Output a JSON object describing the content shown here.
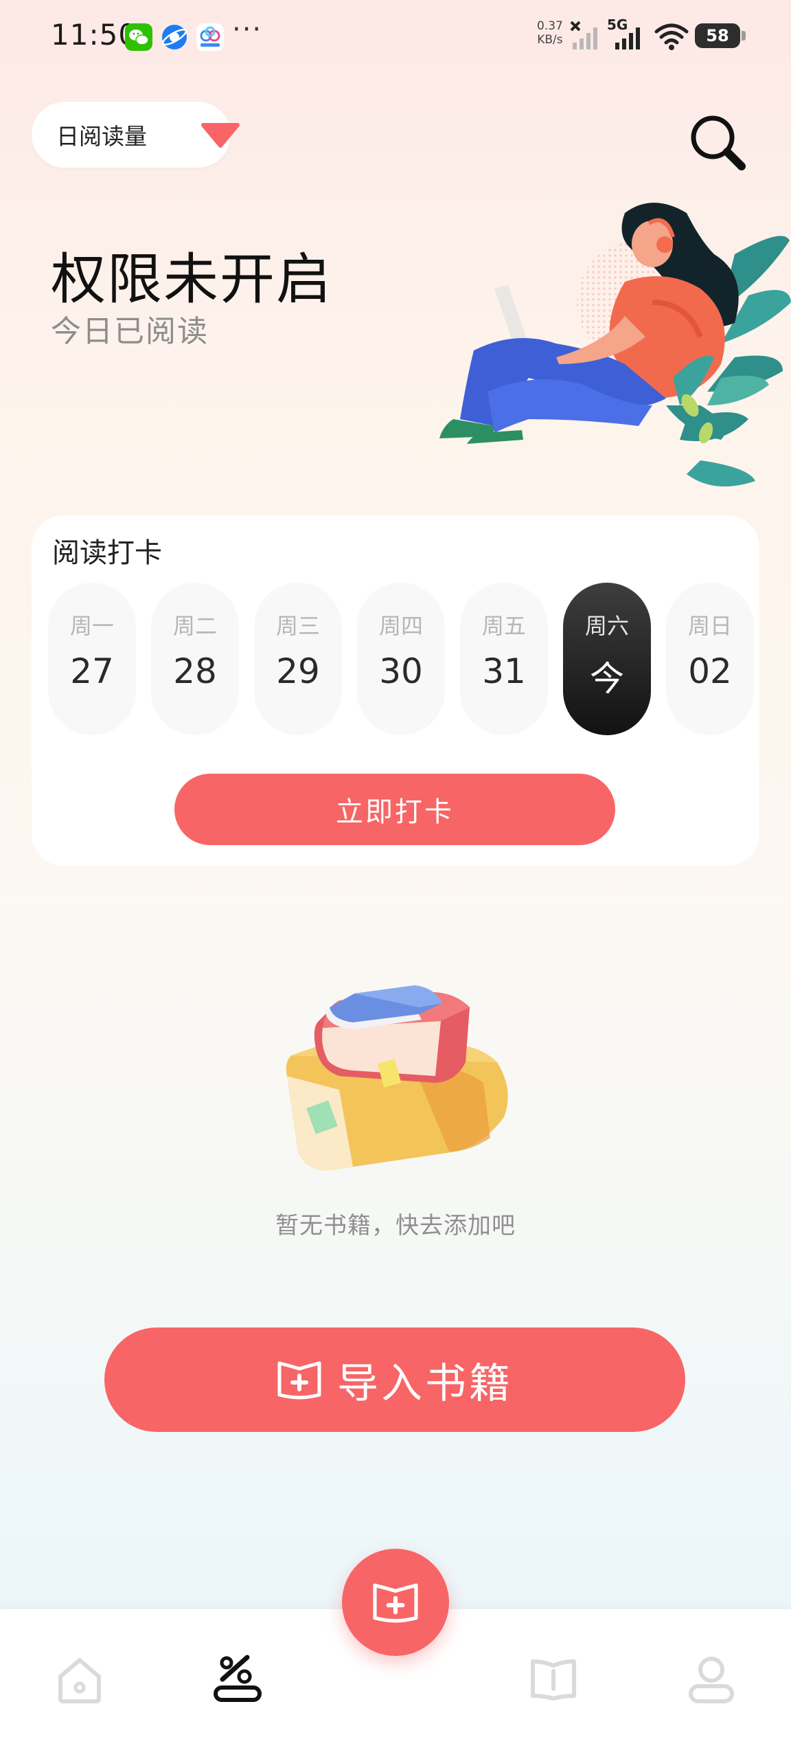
{
  "status_bar": {
    "time": "11:50",
    "net_speed_value": "0.37",
    "net_speed_unit": "KB/s",
    "network": "5G",
    "battery": "58",
    "apps": [
      "wechat-icon",
      "browser-icon",
      "baidu-netdisk-icon"
    ]
  },
  "header": {
    "daily_label": "日阅读量",
    "arrow_icon": "triangle-down-icon",
    "search_icon": "search-icon"
  },
  "hero": {
    "title": "权限未开启",
    "subtitle": "今日已阅读"
  },
  "checkin": {
    "title": "阅读打卡",
    "days": [
      {
        "weekday": "周一",
        "date": "27"
      },
      {
        "weekday": "周二",
        "date": "28"
      },
      {
        "weekday": "周三",
        "date": "29"
      },
      {
        "weekday": "周四",
        "date": "30"
      },
      {
        "weekday": "周五",
        "date": "31"
      },
      {
        "weekday": "周六",
        "date": "今"
      },
      {
        "weekday": "周日",
        "date": "02"
      }
    ],
    "today_index": 5,
    "button_label": "立即打卡"
  },
  "empty_state": {
    "text": "暂无书籍，快去添加吧"
  },
  "import_button": {
    "label": "导入书籍"
  },
  "bottom_nav": {
    "items": [
      "home-icon",
      "discount-icon",
      "add-book-icon",
      "book-icon",
      "profile-icon"
    ],
    "active": "discount-icon"
  },
  "colors": {
    "accent": "#f86566",
    "active_day": "#1a1a1a"
  }
}
